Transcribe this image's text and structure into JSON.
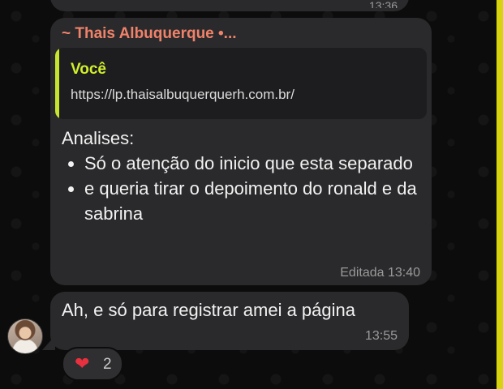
{
  "chat": {
    "previous_message": {
      "time": "13:36"
    },
    "message": {
      "sender": "~ Thais Albuquerque •...",
      "quote": {
        "author": "Você",
        "text": "https://lp.thaisalbuquerquerh.com.br/"
      },
      "heading": "Analises:",
      "bullets": [
        "Só o atenção do inicio que esta separado",
        "e queria tirar o depoimento do ronald e da sabrina"
      ],
      "status": "Editada 13:40"
    },
    "reply": {
      "text": "Ah, e só para registrar amei a página",
      "time": "13:55"
    },
    "reaction": {
      "emoji": "❤",
      "count": "2"
    }
  },
  "colors": {
    "background": "#0c0c0c",
    "bubble": "#2a2a2c",
    "sender_name": "#f0826a",
    "quote_accent": "#c7e52e",
    "side_accent": "#d7d30e",
    "heart": "#e8303e"
  }
}
